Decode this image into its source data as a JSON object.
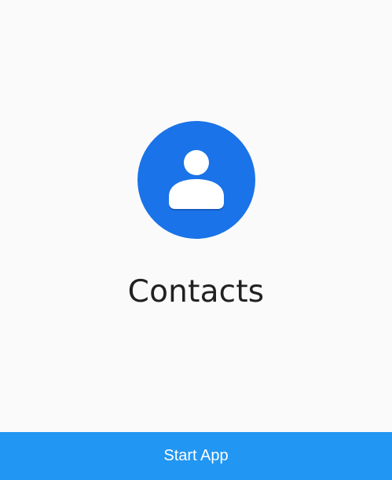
{
  "app": {
    "name": "Contacts",
    "icon": "contacts-person-icon"
  },
  "start_button": {
    "label": "Start App"
  },
  "colors": {
    "background": "#fafafa",
    "icon_circle": "#1a73e8",
    "button": "#2196f3",
    "button_text": "#ffffff",
    "title_text": "#212121"
  }
}
